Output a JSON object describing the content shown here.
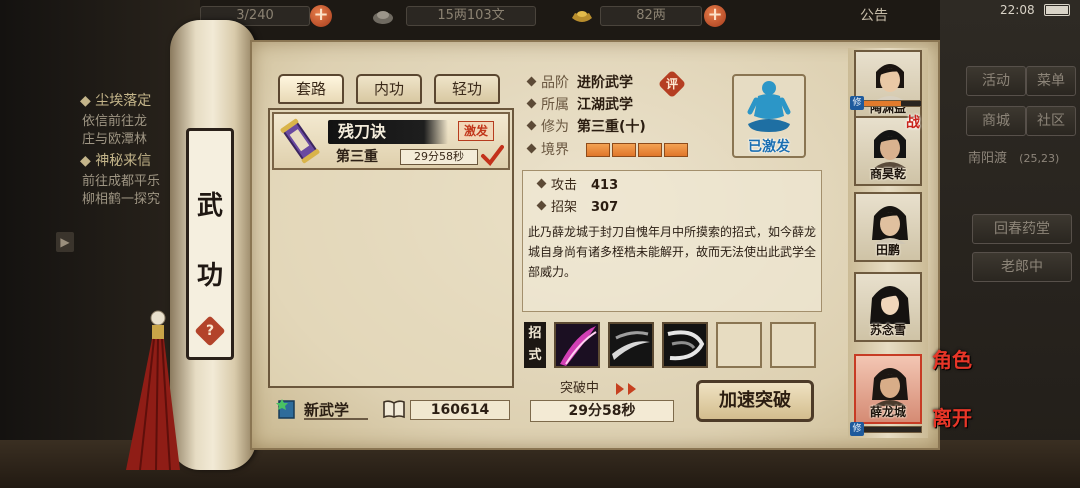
{
  "status_bar": {
    "time": "22:08"
  },
  "top_bar": {
    "capacity": "3/240",
    "silver": "15两103文",
    "gold": "82两",
    "notice": "公告"
  },
  "left_quests": [
    {
      "title": "◆ 尘埃落定",
      "lines": [
        "依信前往龙",
        "庄与欧潭林"
      ]
    },
    {
      "title": "◆ 神秘来信",
      "lines": [
        "前往成都平乐",
        "柳相鹤一探究"
      ]
    }
  ],
  "right_menu": {
    "buttons": [
      "活动",
      "菜单",
      "商城",
      "社区"
    ],
    "location": "南阳渡",
    "coords": "(25,23)",
    "npcs": [
      "回春药堂",
      "老郎中"
    ]
  },
  "scroll_rod": {
    "chars": [
      "武",
      "功"
    ],
    "help": "?"
  },
  "tabs": [
    "套路",
    "内功",
    "轻功"
  ],
  "skill_list": [
    {
      "name": "残刀诀",
      "tag": "激发",
      "level": "第三重",
      "timer": "29分58秒"
    }
  ],
  "footer": {
    "new_skill": "新武学",
    "points": "160614"
  },
  "info": {
    "rank_label": "品阶",
    "rank_value": "进阶武学",
    "rank_badge": "评",
    "school_label": "所属",
    "school_value": "江湖武学",
    "cultivation_label": "修为",
    "cultivation_value": "第三重(十)",
    "realm_label": "境界",
    "realm_segments_filled": 4,
    "portrait_status": "已激发"
  },
  "stats": {
    "attack_label": "攻击",
    "attack_value": "413",
    "parry_label": "招架",
    "parry_value": "307",
    "description": "此乃薛龙城于封刀自愧年月中所摸索的招式，如今薛龙城自身尚有诸多桎梏未能解开，故而无法使出此武学全部威力。"
  },
  "moves": {
    "label": "招式",
    "filled": 3,
    "total": 5
  },
  "breakthrough": {
    "label": "突破中",
    "timer": "29分58秒",
    "speed_button": "加速突破"
  },
  "characters": [
    {
      "name": "陶渊益",
      "level": "修",
      "battle": ""
    },
    {
      "name": "商昊乾",
      "level": "",
      "battle": "战"
    },
    {
      "name": "田鹏",
      "level": "",
      "battle": ""
    },
    {
      "name": "苏念雪",
      "level": "",
      "battle": ""
    },
    {
      "name": "薛龙城",
      "level": "修",
      "battle": ""
    }
  ],
  "side_buttons": {
    "role": "角色",
    "leave": "离开"
  },
  "colors": {
    "accent_orange": "#e0762a",
    "tag_red": "#c1361b",
    "status_blue": "#1b6fb2"
  }
}
